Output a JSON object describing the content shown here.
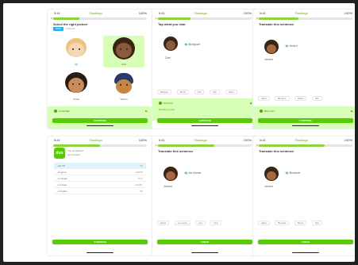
{
  "colors": {
    "brand_green": "#58cc02",
    "light_green": "#d7ffb8",
    "blue": "#1cb0f6",
    "skin_light": "#f6d7b5",
    "skin_dark": "#8b5a3c",
    "hair_dark": "#3b2414",
    "hair_turban": "#243b6b"
  },
  "status": {
    "time": "9:41",
    "app": "Duolingo",
    "battery": "100%"
  },
  "screens": [
    {
      "prompt": "Select the right picture",
      "badge": "NEW",
      "badge_note": "Character",
      "characters": [
        "Lily",
        "Zari",
        "Oscar",
        "Vikram"
      ],
      "selected_index": 1,
      "progress": 0.28,
      "feedback": {
        "msg": "Amazing!",
        "sub": ""
      },
      "cta": "CONTINUE"
    },
    {
      "prompt": "Tap what you hear",
      "speaker": "Zari",
      "speech": "Bonjour!",
      "chips": [
        "Bonjour",
        "Merci",
        "Oui",
        "Non",
        "Salut"
      ],
      "progress": 0.35,
      "feedback": {
        "msg": "Correct!",
        "sub": "Meaning: Hello"
      },
      "cta": "CONTINUE"
    },
    {
      "prompt": "Translate this sentence",
      "speaker": "Junior",
      "speech": "Hello!",
      "chips": [
        "Salut",
        "Bonjour",
        "Merci",
        "Oui"
      ],
      "progress": 0.42,
      "feedback": {
        "msg": "Nice job!",
        "sub": ""
      },
      "cta": "CONTINUE"
    },
    {
      "logo": "duo",
      "info": [
        "You completed",
        "your lesson!"
      ],
      "rows": [
        {
          "c1": "+10 XP",
          "c2": "XP"
        },
        {
          "c1": "+5 gems",
          "c2": "GEMS"
        },
        {
          "c1": "+1 streak",
          "c2": "DAY"
        },
        {
          "c1": "+1 crown",
          "c2": "LEVEL"
        },
        {
          "c1": "+2 hearts",
          "c2": "HP"
        }
      ],
      "highlight_index": 0,
      "progress": 0.5,
      "cta": "CONTINUE"
    },
    {
      "prompt": "Translate this sentence",
      "speaker": "Junior",
      "speech": "Au revoir",
      "chips": [
        "Merci",
        "Au revoir",
        "Oui",
        "Non"
      ],
      "progress": 0.6,
      "cta": "CHECK"
    },
    {
      "prompt": "Translate this sentence",
      "speaker": "Junior",
      "speech": "Bonsoir",
      "chips": [
        "Salut",
        "Bonsoir",
        "Merci",
        "Non"
      ],
      "progress": 0.7,
      "cta": "CHECK"
    }
  ]
}
